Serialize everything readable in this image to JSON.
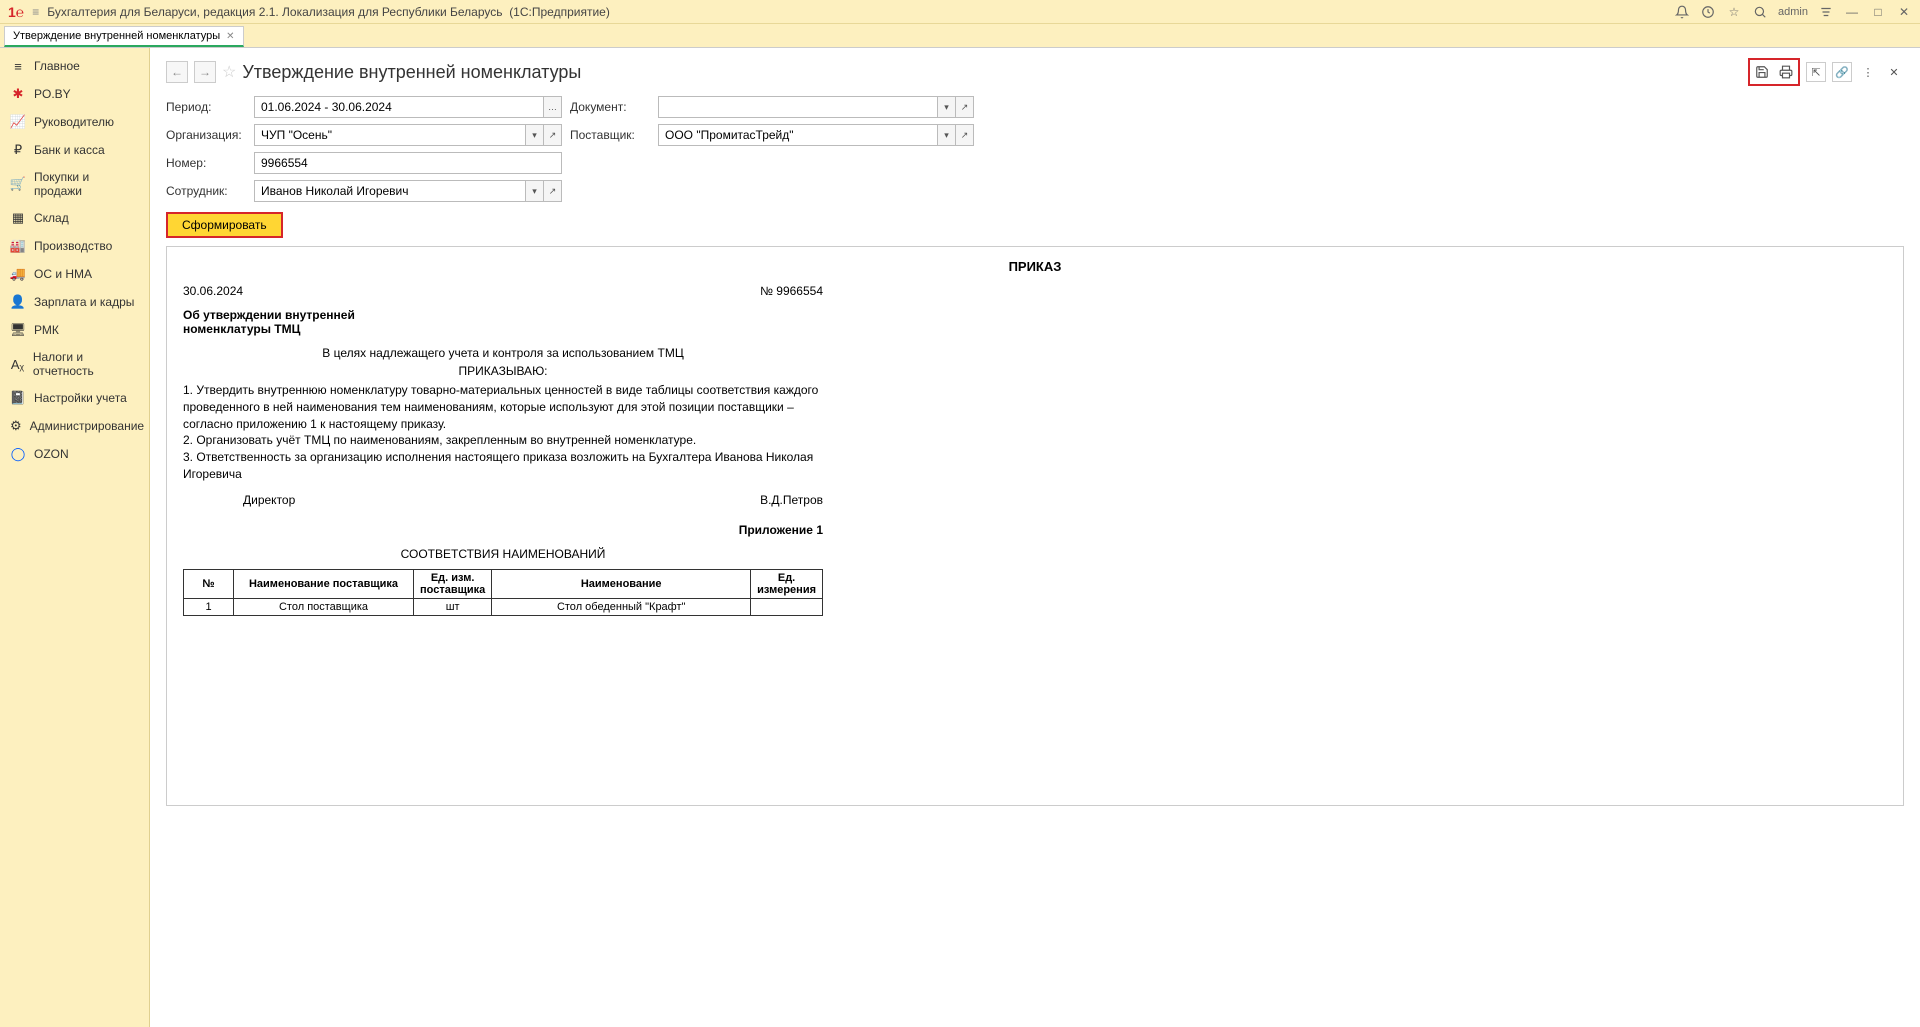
{
  "titlebar": {
    "app_title": "Бухгалтерия для Беларуси, редакция 2.1. Локализация для Республики Беларусь",
    "platform": "(1С:Предприятие)",
    "user": "admin"
  },
  "tab": {
    "label": "Утверждение внутренней номенклатуры"
  },
  "sidebar": {
    "items": [
      {
        "label": "Главное"
      },
      {
        "label": "PO.BY"
      },
      {
        "label": "Руководителю"
      },
      {
        "label": "Банк и касса"
      },
      {
        "label": "Покупки и продажи"
      },
      {
        "label": "Склад"
      },
      {
        "label": "Производство"
      },
      {
        "label": "ОС и НМА"
      },
      {
        "label": "Зарплата и кадры"
      },
      {
        "label": "РМК"
      },
      {
        "label": "Налоги и отчетность"
      },
      {
        "label": "Настройки учета"
      },
      {
        "label": "Администрирование"
      },
      {
        "label": "OZON"
      }
    ]
  },
  "page": {
    "title": "Утверждение внутренней номенклатуры"
  },
  "form": {
    "period_label": "Период:",
    "period_value": "01.06.2024 - 30.06.2024",
    "document_label": "Документ:",
    "document_value": "",
    "org_label": "Организация:",
    "org_value": "ЧУП \"Осень\"",
    "supplier_label": "Поставщик:",
    "supplier_value": "ООО \"ПромитасТрейд\"",
    "number_label": "Номер:",
    "number_value": "9966554",
    "employee_label": "Сотрудник:",
    "employee_value": "Иванов Николай Игоревич",
    "generate_btn": "Сформировать"
  },
  "report": {
    "title": "ПРИКАЗ",
    "date": "30.06.2024",
    "number": "№ 9966554",
    "subtitle": "Об утверждении внутренней номенклатуры ТМЦ",
    "preamble": "В целях надлежащего учета и контроля за использованием ТМЦ",
    "order_word": "ПРИКАЗЫВАЮ:",
    "p1": "1.  Утвердить внутреннюю номенклатуру товарно-материальных ценностей в виде таблицы соответствия каждого проведенного в ней наименования тем наименованиям, которые используют для этой позиции поставщики – согласно приложению 1 к настоящему приказу.",
    "p2": "2.  Организовать учёт ТМЦ по наименованиям, закрепленным во внутренней номенклатуре.",
    "p3": "3.  Ответственность за организацию исполнения настоящего приказа возложить на Бухгалтера Иванова Николая Игоревича",
    "director_label": "Директор",
    "director_name": "В.Д.Петров",
    "appendix": "Приложение 1",
    "table_title": "СООТВЕТСТВИЯ НАИМЕНОВАНИЙ",
    "headers": [
      "№",
      "Наименование поставщика",
      "Ед. изм. поставщика",
      "Наименование",
      "Ед. измерения"
    ],
    "rows": [
      {
        "n": "1",
        "supplier_name": "Стол поставщика",
        "supplier_unit": "шт",
        "name": "Стол обеденный \"Крафт\"",
        "unit": ""
      }
    ]
  }
}
